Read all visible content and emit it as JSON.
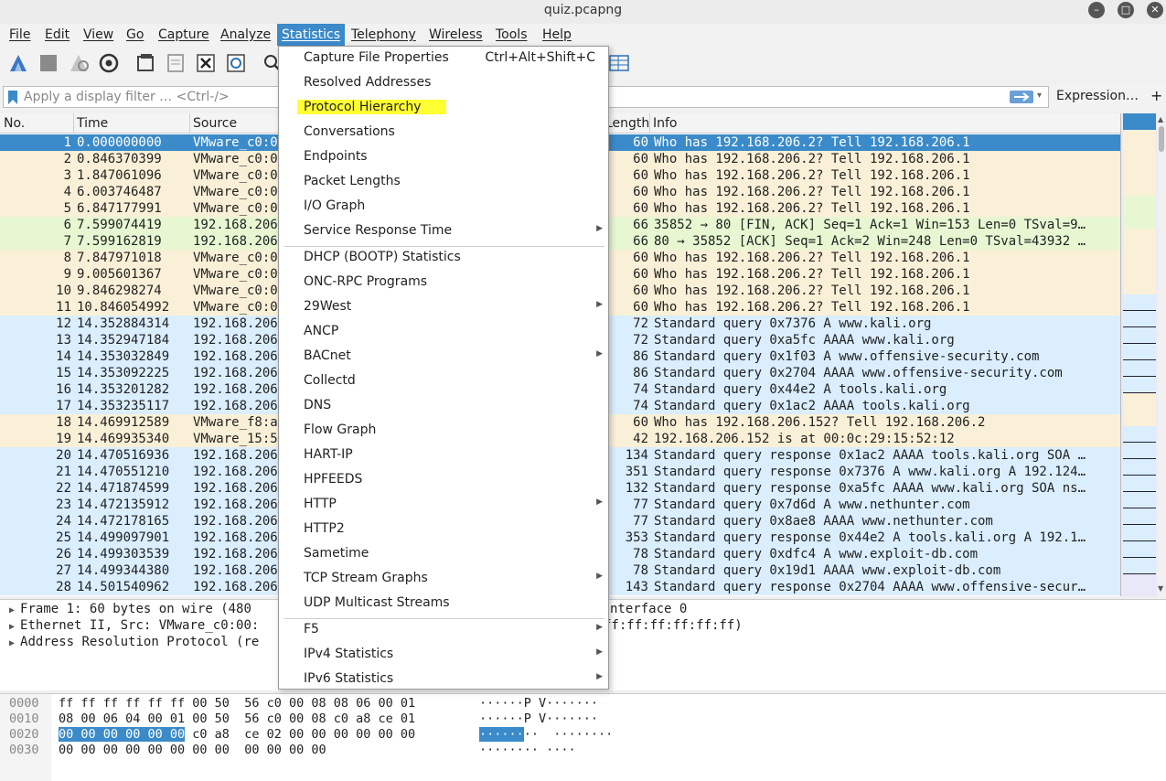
{
  "window": {
    "title": "quiz.pcapng"
  },
  "menubar": {
    "items": [
      "File",
      "Edit",
      "View",
      "Go",
      "Capture",
      "Analyze",
      "Statistics",
      "Telephony",
      "Wireless",
      "Tools",
      "Help"
    ],
    "active": "Statistics"
  },
  "filter": {
    "placeholder": "Apply a display filter … <Ctrl-/>",
    "expression_label": "Expression…",
    "add_label": "+"
  },
  "packet_list": {
    "columns": {
      "no": "No.",
      "time": "Time",
      "source": "Source",
      "length": "Length",
      "info": "Info"
    },
    "rows": [
      {
        "no": "1",
        "time": "0.000000000",
        "src": "VMware_c0:0",
        "len": "60",
        "info": "Who has 192.168.206.2? Tell 192.168.206.1",
        "kind": "selected"
      },
      {
        "no": "2",
        "time": "0.846370399",
        "src": "VMware_c0:0",
        "len": "60",
        "info": "Who has 192.168.206.2? Tell 192.168.206.1",
        "kind": "arp"
      },
      {
        "no": "3",
        "time": "1.847061096",
        "src": "VMware_c0:0",
        "len": "60",
        "info": "Who has 192.168.206.2? Tell 192.168.206.1",
        "kind": "arp"
      },
      {
        "no": "4",
        "time": "6.003746487",
        "src": "VMware_c0:0",
        "len": "60",
        "info": "Who has 192.168.206.2? Tell 192.168.206.1",
        "kind": "arp"
      },
      {
        "no": "5",
        "time": "6.847177991",
        "src": "VMware_c0:0",
        "len": "60",
        "info": "Who has 192.168.206.2? Tell 192.168.206.1",
        "kind": "arp"
      },
      {
        "no": "6",
        "time": "7.599074419",
        "src": "192.168.206",
        "len": "66",
        "info": "35852 → 80 [FIN, ACK] Seq=1 Ack=1 Win=153 Len=0 TSval=9…",
        "kind": "tcp"
      },
      {
        "no": "7",
        "time": "7.599162819",
        "src": "192.168.206",
        "len": "66",
        "info": "80 → 35852 [ACK] Seq=1 Ack=2 Win=248 Len=0 TSval=43932 …",
        "kind": "tcp"
      },
      {
        "no": "8",
        "time": "7.847971018",
        "src": "VMware_c0:0",
        "len": "60",
        "info": "Who has 192.168.206.2? Tell 192.168.206.1",
        "kind": "arp"
      },
      {
        "no": "9",
        "time": "9.005601367",
        "src": "VMware_c0:0",
        "len": "60",
        "info": "Who has 192.168.206.2? Tell 192.168.206.1",
        "kind": "arp"
      },
      {
        "no": "10",
        "time": "9.846298274",
        "src": "VMware_c0:0",
        "len": "60",
        "info": "Who has 192.168.206.2? Tell 192.168.206.1",
        "kind": "arp"
      },
      {
        "no": "11",
        "time": "10.846054992",
        "src": "VMware_c0:0",
        "len": "60",
        "info": "Who has 192.168.206.2? Tell 192.168.206.1",
        "kind": "arp"
      },
      {
        "no": "12",
        "time": "14.352884314",
        "src": "192.168.206",
        "len": "72",
        "info": "Standard query 0x7376 A www.kali.org",
        "kind": "udp"
      },
      {
        "no": "13",
        "time": "14.352947184",
        "src": "192.168.206",
        "len": "72",
        "info": "Standard query 0xa5fc AAAA www.kali.org",
        "kind": "udp"
      },
      {
        "no": "14",
        "time": "14.353032849",
        "src": "192.168.206",
        "len": "86",
        "info": "Standard query 0x1f03 A www.offensive-security.com",
        "kind": "udp"
      },
      {
        "no": "15",
        "time": "14.353092225",
        "src": "192.168.206",
        "len": "86",
        "info": "Standard query 0x2704 AAAA www.offensive-security.com",
        "kind": "udp"
      },
      {
        "no": "16",
        "time": "14.353201282",
        "src": "192.168.206",
        "len": "74",
        "info": "Standard query 0x44e2 A tools.kali.org",
        "kind": "udp"
      },
      {
        "no": "17",
        "time": "14.353235117",
        "src": "192.168.206",
        "len": "74",
        "info": "Standard query 0x1ac2 AAAA tools.kali.org",
        "kind": "udp"
      },
      {
        "no": "18",
        "time": "14.469912589",
        "src": "VMware_f8:a",
        "len": "60",
        "info": "Who has 192.168.206.152? Tell 192.168.206.2",
        "kind": "arp"
      },
      {
        "no": "19",
        "time": "14.469935340",
        "src": "VMware_15:5",
        "len": "42",
        "info": "192.168.206.152 is at 00:0c:29:15:52:12",
        "kind": "arp"
      },
      {
        "no": "20",
        "time": "14.470516936",
        "src": "192.168.206",
        "len": "134",
        "info": "Standard query response 0x1ac2 AAAA tools.kali.org SOA …",
        "kind": "udp"
      },
      {
        "no": "21",
        "time": "14.470551210",
        "src": "192.168.206",
        "len": "351",
        "info": "Standard query response 0x7376 A www.kali.org A 192.124…",
        "kind": "udp"
      },
      {
        "no": "22",
        "time": "14.471874599",
        "src": "192.168.206",
        "len": "132",
        "info": "Standard query response 0xa5fc AAAA www.kali.org SOA ns…",
        "kind": "udp"
      },
      {
        "no": "23",
        "time": "14.472135912",
        "src": "192.168.206",
        "len": "77",
        "info": "Standard query 0x7d6d A www.nethunter.com",
        "kind": "udp"
      },
      {
        "no": "24",
        "time": "14.472178165",
        "src": "192.168.206",
        "len": "77",
        "info": "Standard query 0x8ae8 AAAA www.nethunter.com",
        "kind": "udp"
      },
      {
        "no": "25",
        "time": "14.499097901",
        "src": "192.168.206",
        "len": "353",
        "info": "Standard query response 0x44e2 A tools.kali.org A 192.1…",
        "kind": "udp"
      },
      {
        "no": "26",
        "time": "14.499303539",
        "src": "192.168.206",
        "len": "78",
        "info": "Standard query 0xdfc4 A www.exploit-db.com",
        "kind": "udp"
      },
      {
        "no": "27",
        "time": "14.499344380",
        "src": "192.168.206",
        "len": "78",
        "info": "Standard query 0x19d1 AAAA www.exploit-db.com",
        "kind": "udp"
      },
      {
        "no": "28",
        "time": "14.501540962",
        "src": "192.168.206",
        "len": "143",
        "info": "Standard query response 0x2704 AAAA www.offensive-secur…",
        "kind": "udp"
      }
    ]
  },
  "details": {
    "lines": [
      {
        "left": "Frame 1: 60 bytes on wire (480",
        "right": "nterface 0"
      },
      {
        "left": "Ethernet II, Src: VMware_c0:00:",
        "right": "ff:ff:ff:ff:ff:ff)"
      },
      {
        "left": "Address Resolution Protocol (re",
        "right": ""
      }
    ]
  },
  "hex": {
    "rows": [
      {
        "offset": "0000",
        "sel": "",
        "bytes": "ff ff ff ff ff ff 00 50  56 c0 00 08 08 06 00 01",
        "ascii_sel": "",
        "ascii": "······P V·······"
      },
      {
        "offset": "0010",
        "sel": "",
        "bytes": "08 00 06 04 00 01 00 50  56 c0 00 08 c0 a8 ce 01",
        "ascii_sel": "",
        "ascii": "······P V·······"
      },
      {
        "offset": "0020",
        "sel": "00 00 00 00 00 00",
        "bytes": " c0 a8  ce 02 00 00 00 00 00 00",
        "ascii_sel": "······",
        "ascii": "··  ········"
      },
      {
        "offset": "0030",
        "sel": "",
        "bytes": "00 00 00 00 00 00 00 00  00 00 00 00",
        "ascii_sel": "",
        "ascii": "········ ····"
      }
    ]
  },
  "statistics_menu": {
    "items": [
      {
        "label": "Capture File Properties",
        "shortcut": "Ctrl+Alt+Shift+C"
      },
      {
        "label": "Resolved Addresses"
      },
      {
        "label": "Protocol Hierarchy",
        "highlighted": true
      },
      {
        "label": "Conversations"
      },
      {
        "label": "Endpoints"
      },
      {
        "label": "Packet Lengths"
      },
      {
        "label": "I/O Graph"
      },
      {
        "label": "Service Response Time",
        "submenu": true
      },
      {
        "separator": true
      },
      {
        "label": "DHCP (BOOTP) Statistics"
      },
      {
        "label": "ONC-RPC Programs"
      },
      {
        "label": "29West",
        "submenu": true
      },
      {
        "label": "ANCP"
      },
      {
        "label": "BACnet",
        "submenu": true
      },
      {
        "label": "Collectd"
      },
      {
        "label": "DNS"
      },
      {
        "label": "Flow Graph"
      },
      {
        "label": "HART-IP"
      },
      {
        "label": "HPFEEDS"
      },
      {
        "label": "HTTP",
        "submenu": true
      },
      {
        "label": "HTTP2"
      },
      {
        "label": "Sametime"
      },
      {
        "label": "TCP Stream Graphs",
        "submenu": true
      },
      {
        "label": "UDP Multicast Streams"
      },
      {
        "separator": true
      },
      {
        "label": "F5",
        "submenu": true
      },
      {
        "label": "IPv4 Statistics",
        "submenu": true
      },
      {
        "label": "IPv6 Statistics",
        "submenu": true
      }
    ]
  },
  "colors": {
    "selected_row": "#3b8ac9",
    "arp_row": "#faf0d7",
    "tcp_row": "#e7f7d2",
    "udp_row": "#daeefe",
    "highlight": "#ffff33",
    "menu_active": "#3b8ac9"
  }
}
